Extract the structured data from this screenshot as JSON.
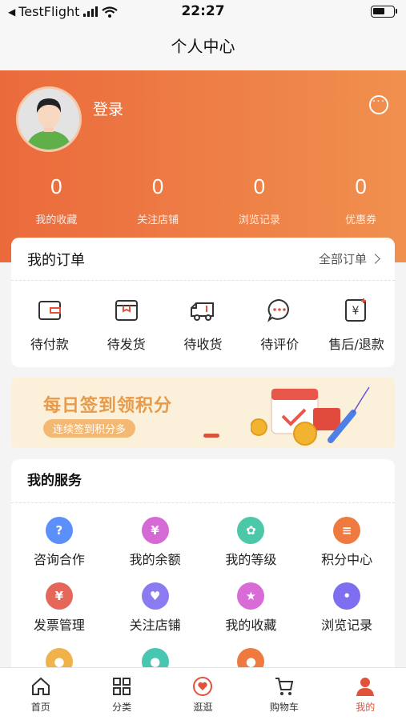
{
  "status_bar": {
    "back_app": "TestFlight",
    "time": "22:27"
  },
  "nav": {
    "title": "个人中心"
  },
  "profile": {
    "login_label": "登录",
    "stats": [
      {
        "value": "0",
        "label": "我的收藏"
      },
      {
        "value": "0",
        "label": "关注店铺"
      },
      {
        "value": "0",
        "label": "浏览记录"
      },
      {
        "value": "0",
        "label": "优惠券"
      }
    ]
  },
  "orders": {
    "title": "我的订单",
    "all_label": "全部订单",
    "items": [
      {
        "label": "待付款",
        "icon": "wallet-icon"
      },
      {
        "label": "待发货",
        "icon": "box-icon"
      },
      {
        "label": "待收货",
        "icon": "truck-icon"
      },
      {
        "label": "待评价",
        "icon": "chat-icon"
      },
      {
        "label": "售后/退款",
        "icon": "refund-icon"
      }
    ]
  },
  "banner": {
    "title": "每日签到领积分",
    "subtitle": "连续签到积分多"
  },
  "services": {
    "title": "我的服务",
    "items": [
      {
        "label": "咨询合作",
        "icon": "question-icon",
        "color": "#5b8ff9"
      },
      {
        "label": "我的余额",
        "icon": "money-bag-icon",
        "color": "#d66ad4"
      },
      {
        "label": "我的等级",
        "icon": "medal-icon",
        "color": "#4cc7a8"
      },
      {
        "label": "积分中心",
        "icon": "coins-icon",
        "color": "#ef7a3f"
      },
      {
        "label": "发票管理",
        "icon": "invoice-icon",
        "color": "#e5675a"
      },
      {
        "label": "关注店铺",
        "icon": "heart-icon",
        "color": "#8a7cf0"
      },
      {
        "label": "我的收藏",
        "icon": "star-icon",
        "color": "#d86bd6"
      },
      {
        "label": "浏览记录",
        "icon": "footprint-icon",
        "color": "#7d6ff0"
      },
      {
        "label": "",
        "icon": "user-icon",
        "color": "#f0b24a"
      },
      {
        "label": "",
        "icon": "bird-icon",
        "color": "#47c6b1"
      },
      {
        "label": "",
        "icon": "location-icon",
        "color": "#ef7a3f"
      }
    ]
  },
  "tabs": [
    {
      "label": "首页",
      "icon": "home-icon"
    },
    {
      "label": "分类",
      "icon": "grid-icon"
    },
    {
      "label": "逛逛",
      "icon": "heart-chat-icon"
    },
    {
      "label": "购物车",
      "icon": "cart-icon"
    },
    {
      "label": "我的",
      "icon": "person-icon"
    }
  ],
  "colors": {
    "accent": "#e0533a",
    "header_start": "#eb6a3c",
    "header_end": "#f0904e"
  }
}
